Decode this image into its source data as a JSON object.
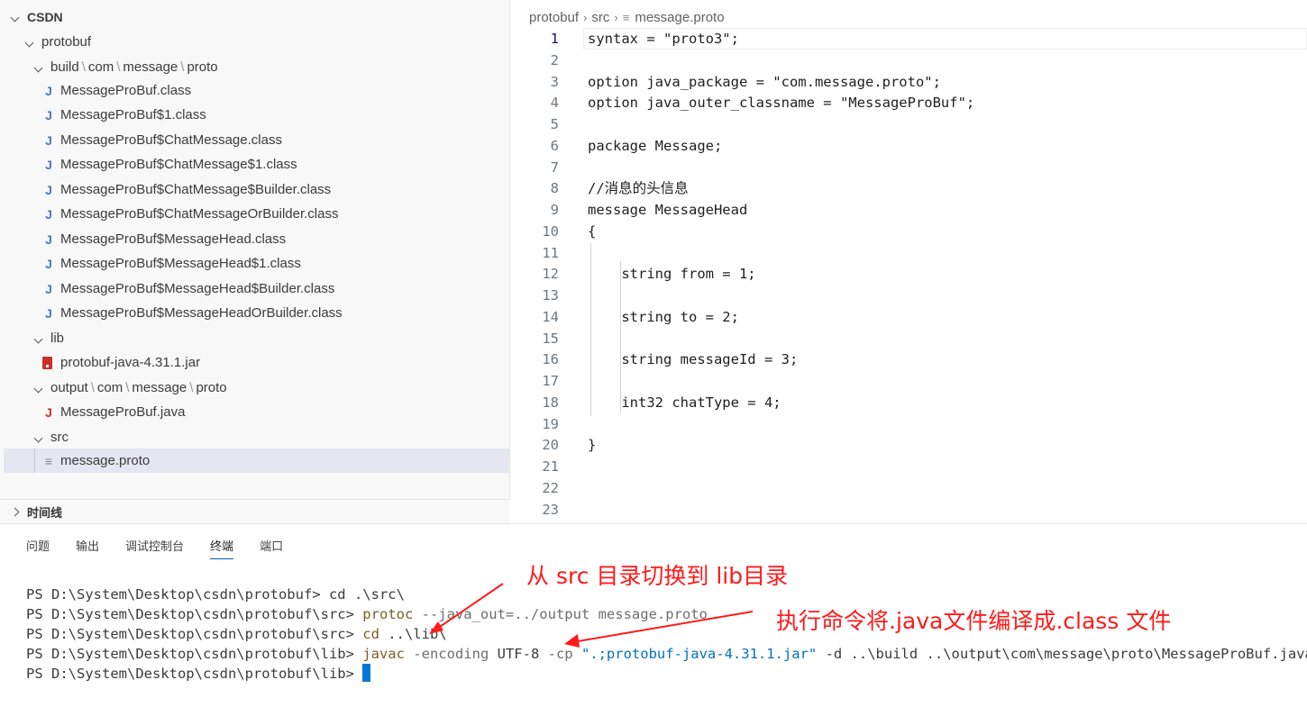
{
  "explorer": {
    "root": "CSDN",
    "items": [
      {
        "label": "protobuf",
        "kind": "folder-open",
        "depth": 1
      },
      {
        "label_parts": [
          "build",
          "com",
          "message",
          "proto"
        ],
        "kind": "folder-open",
        "depth": 2
      },
      {
        "label": "MessageProBuf.class",
        "kind": "java-class"
      },
      {
        "label": "MessageProBuf$1.class",
        "kind": "java-class"
      },
      {
        "label": "MessageProBuf$ChatMessage.class",
        "kind": "java-class"
      },
      {
        "label": "MessageProBuf$ChatMessage$1.class",
        "kind": "java-class"
      },
      {
        "label": "MessageProBuf$ChatMessage$Builder.class",
        "kind": "java-class"
      },
      {
        "label": "MessageProBuf$ChatMessageOrBuilder.class",
        "kind": "java-class"
      },
      {
        "label": "MessageProBuf$MessageHead.class",
        "kind": "java-class"
      },
      {
        "label": "MessageProBuf$MessageHead$1.class",
        "kind": "java-class"
      },
      {
        "label": "MessageProBuf$MessageHead$Builder.class",
        "kind": "java-class"
      },
      {
        "label": "MessageProBuf$MessageHeadOrBuilder.class",
        "kind": "java-class"
      },
      {
        "label": "lib",
        "kind": "folder-open"
      },
      {
        "label": "protobuf-java-4.31.1.jar",
        "kind": "jar"
      },
      {
        "label_parts": [
          "output",
          "com",
          "message",
          "proto"
        ],
        "kind": "folder-open"
      },
      {
        "label": "MessageProBuf.java",
        "kind": "java-src"
      },
      {
        "label": "src",
        "kind": "folder-open"
      },
      {
        "label": "message.proto",
        "kind": "proto",
        "selected": true
      }
    ],
    "timeline_label": "时间线"
  },
  "editor": {
    "breadcrumb": [
      "protobuf",
      "src",
      "message.proto"
    ],
    "lines": [
      "syntax = \"proto3\";",
      "",
      "option java_package = \"com.message.proto\";",
      "option java_outer_classname = \"MessageProBuf\";",
      "",
      "package Message;",
      "",
      "//消息的头信息",
      "message MessageHead",
      "{",
      "",
      "    string from = 1;",
      "",
      "    string to = 2;",
      "",
      "    string messageId = 3;",
      "",
      "    int32 chatType = 4;",
      "",
      "}",
      "",
      "",
      ""
    ],
    "line_numbers": [
      "1",
      "2",
      "3",
      "4",
      "5",
      "6",
      "7",
      "8",
      "9",
      "10",
      "11",
      "12",
      "13",
      "14",
      "15",
      "16",
      "17",
      "18",
      "19",
      "20",
      "21",
      "22",
      "23"
    ]
  },
  "panel": {
    "tabs": [
      "问题",
      "输出",
      "调试控制台",
      "终端",
      "端口"
    ],
    "active_tab": "终端",
    "terminal": [
      {
        "prompt": "PS D:\\System\\Desktop\\csdn\\protobuf> ",
        "cmd": "",
        "rest": "cd .\\src\\"
      },
      {
        "prompt": "PS D:\\System\\Desktop\\csdn\\protobuf\\src> ",
        "cmd": "protoc",
        "rest": " --java_out=../output message.proto"
      },
      {
        "prompt": "PS D:\\System\\Desktop\\csdn\\protobuf\\src> ",
        "cmd": "cd",
        "rest": " ..\\lib\\"
      },
      {
        "prompt": "PS D:\\System\\Desktop\\csdn\\protobuf\\lib> ",
        "cmd": "javac",
        "flag1": " -encoding",
        "mid": " UTF-8 ",
        "flag2": "-cp",
        "str": " \".;protobuf-java-4.31.1.jar\"",
        "rest": " -d ..\\build ..\\output\\com\\message\\proto\\MessageProBuf.java"
      },
      {
        "prompt": "PS D:\\System\\Desktop\\csdn\\protobuf\\lib> ",
        "cmd": "",
        "rest": ""
      }
    ]
  },
  "annotations": {
    "note1": "从 src 目录切换到 lib目录",
    "note2": "执行命令将.java文件编译成.class 文件",
    "color": "#ff1a1a"
  },
  "colors": {
    "selection": "#e4e6f1",
    "accent": "#005fb8",
    "cursor": "#0078d4"
  }
}
